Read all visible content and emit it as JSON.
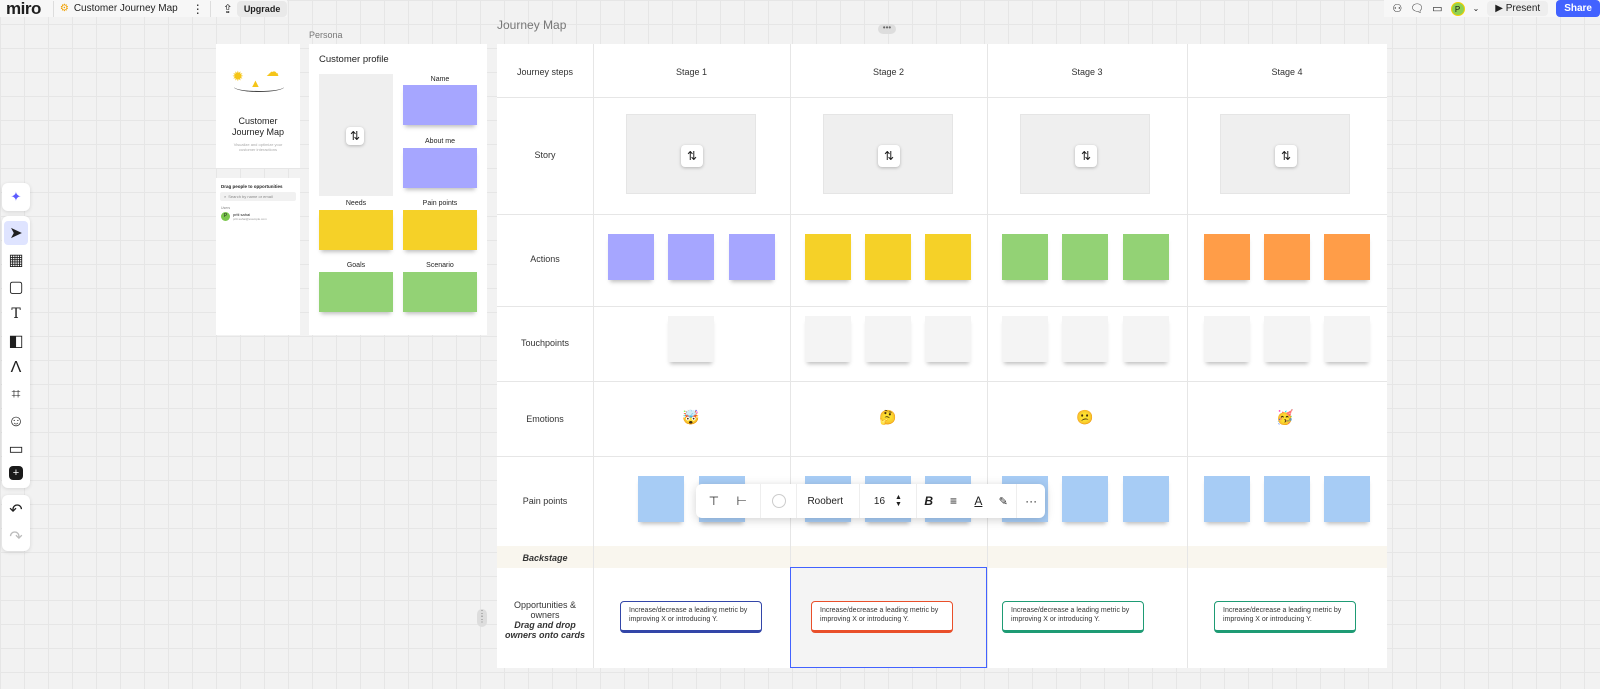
{
  "app": {
    "logo": "miro",
    "board_title": "Customer Journey Map",
    "upgrade_label": "Upgrade"
  },
  "topbar": {
    "present_label": "Present",
    "share_label": "Share",
    "avatar_initial": "P"
  },
  "cover": {
    "title_line1": "Customer",
    "title_line2": "Journey Map",
    "subtitle": "Visualize and optimize your customer interactions"
  },
  "people_panel": {
    "title": "Drag people to opportunities",
    "search_placeholder": "Search by name or email",
    "section": "Users",
    "user_name": "priti sahai",
    "user_email": "priti.sahai@example.com",
    "user_initial": "P"
  },
  "persona": {
    "frame_label": "Persona",
    "title": "Customer profile",
    "labels": {
      "name": "Name",
      "about": "About me",
      "needs": "Needs",
      "pain": "Pain points",
      "goals": "Goals",
      "scenario": "Scenario"
    }
  },
  "journey": {
    "frame_label": "Journey Map",
    "header_first": "Journey steps",
    "stages": [
      "Stage 1",
      "Stage 2",
      "Stage 3",
      "Stage 4"
    ],
    "rows": {
      "story": "Story",
      "actions": "Actions",
      "touchpoints": "Touchpoints",
      "emotions": "Emotions",
      "pain": "Pain points",
      "backstage": "Backstage",
      "opp1": "Opportunities &",
      "opp2": "owners",
      "opp3": "Drag and drop",
      "opp4": "owners onto cards"
    },
    "emojis": [
      "🤯",
      "🤔",
      "😕",
      "🥳"
    ],
    "opp_text_1": "Increase/decrease a leading metric by",
    "opp_text_2": "improving X or introducing Y.",
    "opp_colors": [
      "#3346a8",
      "#e94f2a",
      "#1e9b74",
      "#1e9b74"
    ]
  },
  "format_bar": {
    "font": "Roobert",
    "size": "16"
  }
}
